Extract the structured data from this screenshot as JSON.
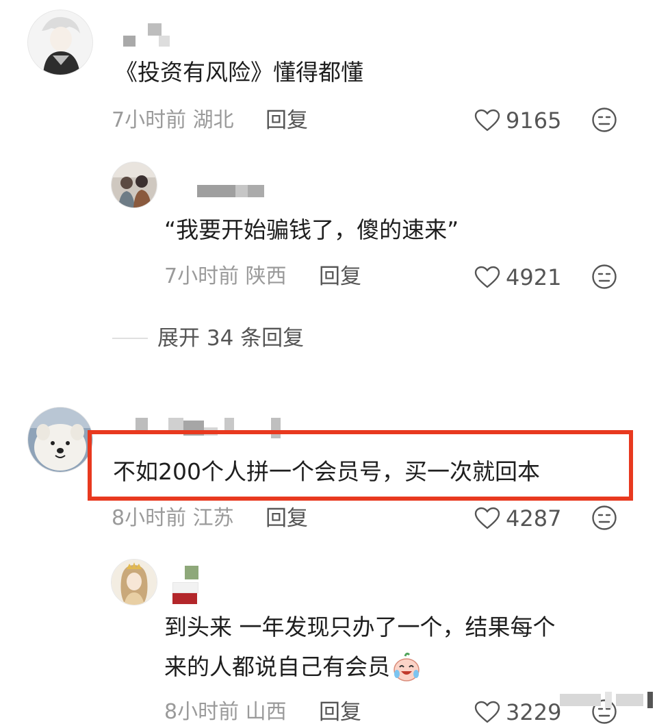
{
  "comments": [
    {
      "text": "《投资有风险》懂得都懂",
      "time": "7小时前",
      "location": "湖北",
      "reply_label": "回复",
      "likes": "9165",
      "replies": [
        {
          "text": "“我要开始骗钱了，傻的速来”",
          "time": "7小时前",
          "location": "陕西",
          "reply_label": "回复",
          "likes": "4921"
        }
      ],
      "expand_label": "展开 34 条回复"
    },
    {
      "text": "不如200个人拼一个会员号，买一次就回本",
      "time": "8小时前",
      "location": "江苏",
      "reply_label": "回复",
      "likes": "4287",
      "highlighted": true,
      "replies": [
        {
          "text_line1": "到头来 一年发现只办了一个，结果每个",
          "text_line2": "来的人都说自己有会员",
          "time": "8小时前",
          "location": "山西",
          "reply_label": "回复",
          "likes": "3229"
        }
      ]
    }
  ],
  "icons": {
    "like": "heart-outline-icon",
    "emoji": "meh-face-icon"
  },
  "colors": {
    "highlight": "#e8391f",
    "meta": "#9a9a9a",
    "action": "#555555"
  }
}
